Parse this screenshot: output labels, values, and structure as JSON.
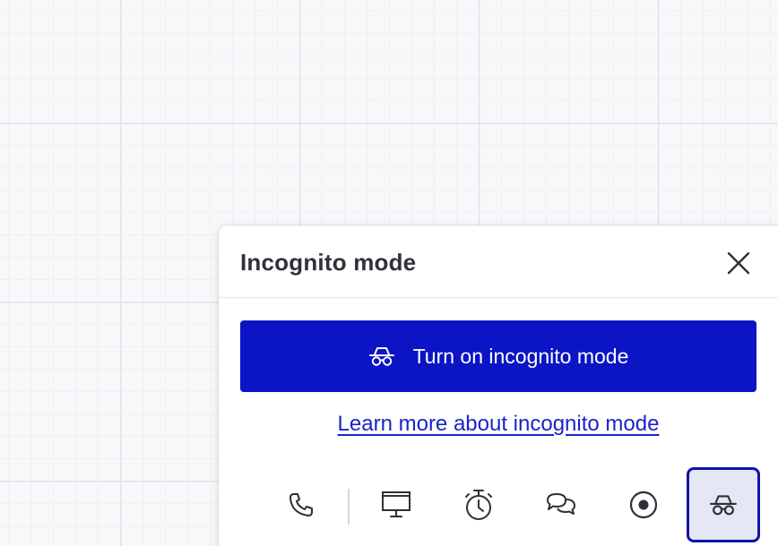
{
  "panel": {
    "title": "Incognito mode",
    "close_icon": "close-icon",
    "primary_button": {
      "label": "Turn on incognito mode",
      "icon": "incognito-icon",
      "color": "#0b15c6"
    },
    "learn_link": "Learn more about incognito mode"
  },
  "toolbar": {
    "items": [
      {
        "icon": "phone-icon",
        "active": false
      },
      {
        "icon": "presentation-icon",
        "active": false
      },
      {
        "icon": "timer-icon",
        "active": false
      },
      {
        "icon": "chat-icon",
        "active": false
      },
      {
        "icon": "record-icon",
        "active": false
      },
      {
        "icon": "incognito-icon",
        "active": true
      }
    ]
  },
  "colors": {
    "accent": "#0b15c6",
    "link": "#1b24c8",
    "active_border": "#0b15a8",
    "active_bg": "#e6e7f5",
    "canvas_bg": "#f8f8fb"
  }
}
